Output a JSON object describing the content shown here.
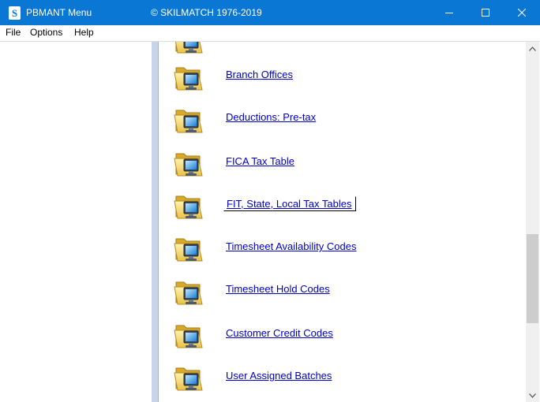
{
  "window": {
    "title": "PBMANT Menu",
    "copyright": "© SKILMATCH 1976-2019",
    "app_icon_letter": "S",
    "accent_color": "#0a77d4"
  },
  "menu": {
    "items": [
      "File",
      "Options",
      "Help"
    ]
  },
  "items": [
    {
      "label": "Branch Offices",
      "icon": "computer-folder-icon"
    },
    {
      "label": "Deductions:  Pre-tax",
      "icon": "computer-folder-icon"
    },
    {
      "label": "FICA Tax Table",
      "icon": "computer-folder-icon"
    },
    {
      "label": "FIT, State, Local Tax Tables",
      "icon": "computer-folder-icon",
      "focused": true
    },
    {
      "label": "Timesheet Availability Codes",
      "icon": "computer-folder-icon"
    },
    {
      "label": "Timesheet Hold Codes",
      "icon": "computer-folder-icon"
    },
    {
      "label": "Customer Credit Codes",
      "icon": "computer-folder-icon"
    },
    {
      "label": "User Assigned Batches",
      "icon": "computer-folder-icon"
    }
  ],
  "link_color": "#0000cc"
}
